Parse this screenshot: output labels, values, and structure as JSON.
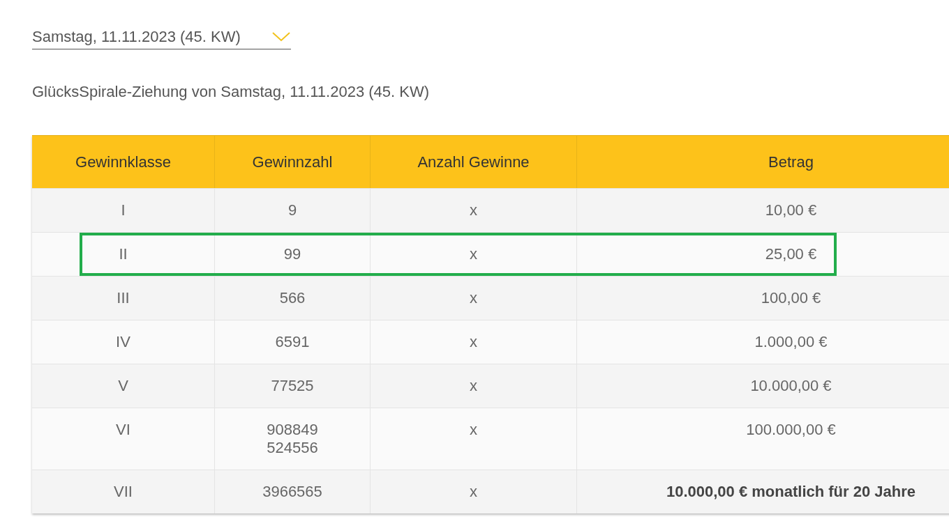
{
  "date_select": {
    "value": "Samstag, 11.11.2023 (45. KW)"
  },
  "heading": "GlücksSpirale-Ziehung von Samstag, 11.11.2023 (45. KW)",
  "table": {
    "columns": [
      "Gewinnklasse",
      "Gewinnzahl",
      "Anzahl Gewinne",
      "Betrag"
    ],
    "rows": [
      {
        "class": "I",
        "numbers": [
          "9"
        ],
        "count": "x",
        "amount": "10,00 €",
        "emphasized": false,
        "highlighted": false
      },
      {
        "class": "II",
        "numbers": [
          "99"
        ],
        "count": "x",
        "amount": "25,00 €",
        "emphasized": false,
        "highlighted": true
      },
      {
        "class": "III",
        "numbers": [
          "566"
        ],
        "count": "x",
        "amount": "100,00 €",
        "emphasized": false,
        "highlighted": false
      },
      {
        "class": "IV",
        "numbers": [
          "6591"
        ],
        "count": "x",
        "amount": "1.000,00 €",
        "emphasized": false,
        "highlighted": false
      },
      {
        "class": "V",
        "numbers": [
          "77525"
        ],
        "count": "x",
        "amount": "10.000,00 €",
        "emphasized": false,
        "highlighted": false
      },
      {
        "class": "VI",
        "numbers": [
          "908849",
          "524556"
        ],
        "count": "x",
        "amount": "100.000,00 €",
        "emphasized": false,
        "highlighted": false
      },
      {
        "class": "VII",
        "numbers": [
          "3966565"
        ],
        "count": "x",
        "amount": "10.000,00 € monatlich für 20 Jahre",
        "emphasized": true,
        "highlighted": false
      }
    ]
  }
}
